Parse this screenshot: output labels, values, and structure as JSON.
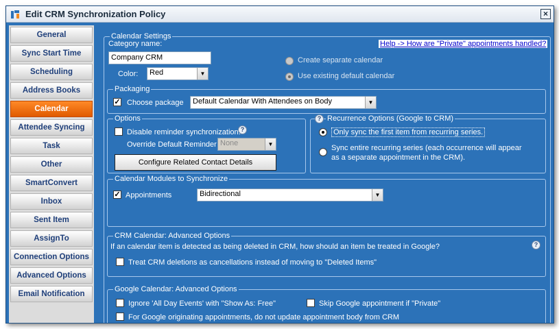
{
  "window": {
    "title": "Edit CRM Synchronization Policy",
    "close_glyph": "×"
  },
  "sidebar": {
    "items": [
      {
        "label": "General"
      },
      {
        "label": "Sync Start Time"
      },
      {
        "label": "Scheduling"
      },
      {
        "label": "Address Books"
      },
      {
        "label": "Calendar",
        "active": true
      },
      {
        "label": "Attendee Syncing"
      },
      {
        "label": "Task"
      },
      {
        "label": "Other"
      },
      {
        "label": "SmartConvert"
      },
      {
        "label": "Inbox"
      },
      {
        "label": "Sent Item"
      },
      {
        "label": "AssignTo"
      },
      {
        "label": "Connection Options"
      },
      {
        "label": "Advanced Options"
      },
      {
        "label": "Email Notification"
      }
    ]
  },
  "calendar_settings": {
    "legend": "Calendar Settings",
    "category_label": "Category name:",
    "category_value": "Company CRM",
    "color_label": "Color:",
    "color_value": "Red",
    "help_link": "Help -> How are \"Private\" appointments handled?",
    "radio_create_separate": "Create separate calendar",
    "radio_use_existing": "Use existing default calendar",
    "selected_radio": "use_existing"
  },
  "packaging": {
    "legend": "Packaging",
    "choose_package_label": "Choose package",
    "choose_package_checked": true,
    "package_value": "Default Calendar With Attendees on Body"
  },
  "options": {
    "legend": "Options",
    "disable_reminder_label": "Disable reminder synchronization.",
    "disable_reminder_checked": false,
    "override_label": "Override Default Reminder",
    "override_value": "None",
    "configure_button": "Configure Related Contact Details"
  },
  "recurrence": {
    "legend": "Recurrence Options (Google to CRM)",
    "option_first": "Only sync the first item from recurring series.",
    "option_entire_line1": "Sync entire recurring series (each occurrence will appear",
    "option_entire_line2": "as a separate appointment in the CRM).",
    "selected": "first"
  },
  "modules": {
    "legend": "Calendar Modules to Synchronize",
    "appointments_label": "Appointments",
    "appointments_checked": true,
    "direction_value": "Bidirectional"
  },
  "crm_advanced": {
    "legend": "CRM Calendar: Advanced Options",
    "question": "If an calendar item is detected as being deleted in CRM, how should an item be treated in Google?",
    "treat_label": "Treat CRM deletions as cancellations instead of moving to \"Deleted Items\"",
    "treat_checked": false
  },
  "google_advanced": {
    "legend": "Google Calendar: Advanced Options",
    "ignore_all_day_label": "Ignore 'All Day Events' with \"Show As: Free\"",
    "skip_private_label": "Skip Google appointment if \"Private\"",
    "no_update_body_label": "For Google originating appointments, do not update appointment body from CRM"
  },
  "icons": {
    "app": "crm-app-icon",
    "help": "help-question-icon",
    "dropdown": "chevron-down-icon",
    "check_glyph": "✓",
    "help_glyph": "?",
    "dropdown_glyph": "▼"
  }
}
